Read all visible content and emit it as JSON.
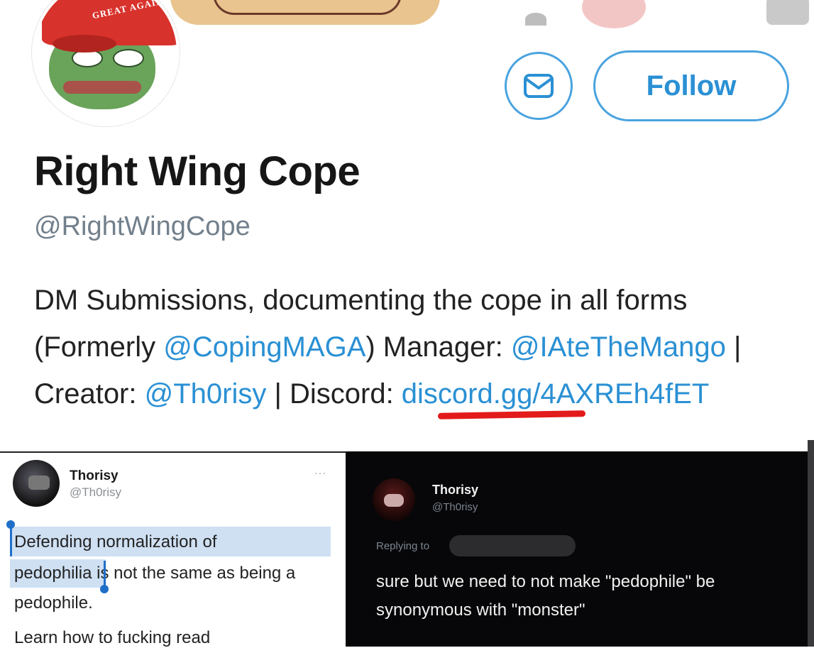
{
  "profile": {
    "hat_text": "GREAT AGAIN",
    "display_name": "Right Wing Cope",
    "handle": "@RightWingCope",
    "message_icon": "envelope-icon",
    "follow_label": "Follow",
    "bio": {
      "t1": "DM Submissions, documenting the cope in all forms (Formerly ",
      "link1": "@CopingMAGA",
      "t2": ") Manager: ",
      "link2": "@IAteTheMango",
      "t3": " | Creator: ",
      "link3": "@Th0risy",
      "t4": " | Discord: ",
      "link4": "discord.gg/4AXREh4fET"
    },
    "accent_color": "#2a90d4",
    "annotation_color": "#e31b1b"
  },
  "tweet_light": {
    "name": "Thorisy",
    "handle": "@Th0risy",
    "more": "···",
    "line1": "Defending normalization of",
    "line2a": "pedophilia",
    "line2b": " is not the same as being a",
    "line3": "pedophile.",
    "line4": "Learn how to fucking read"
  },
  "tweet_dark": {
    "name": "Thorisy",
    "handle": "@Th0risy",
    "replying_to": "Replying to",
    "text": "sure but we need to not make \"pedophile\" be synonymous with \"monster\""
  }
}
